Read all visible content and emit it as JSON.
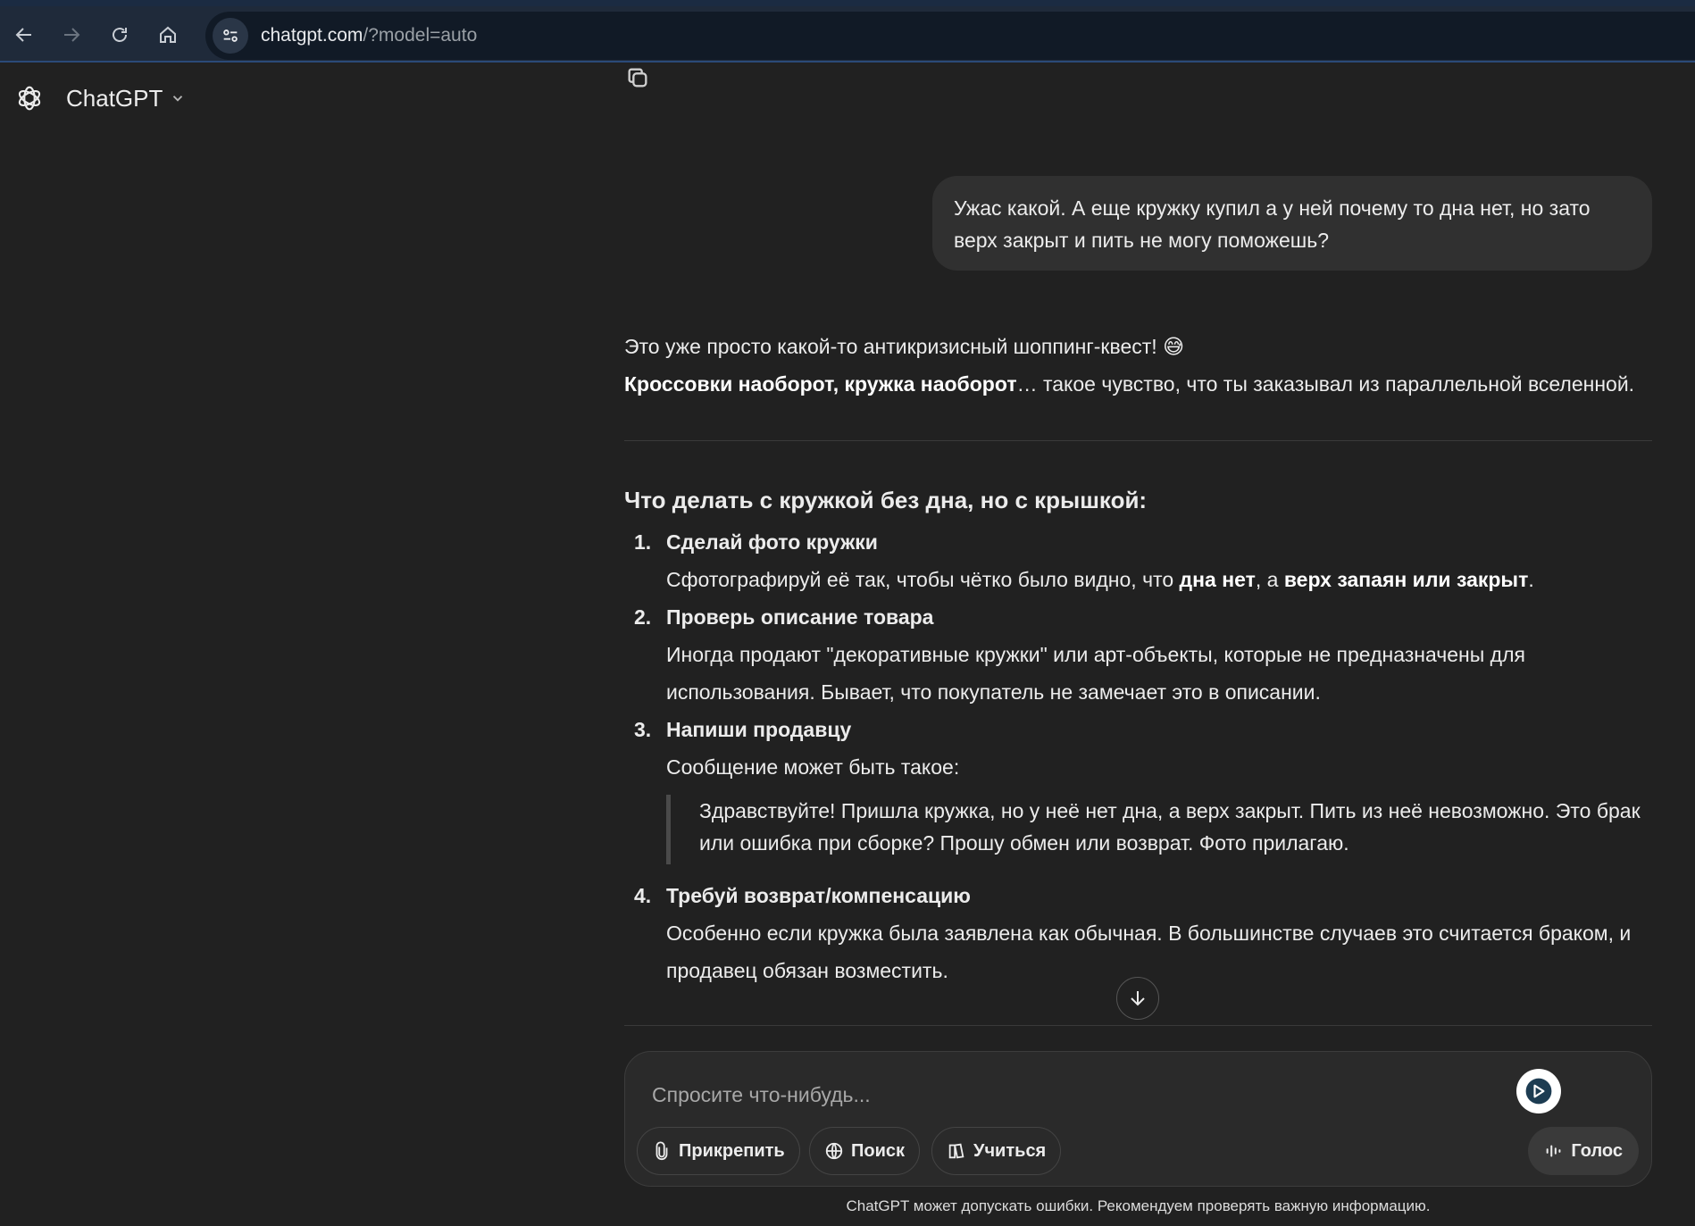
{
  "browser": {
    "url_host": "chatgpt.com",
    "url_path": "/?model=auto"
  },
  "app": {
    "title": "ChatGPT"
  },
  "conversation": {
    "user_message": "Ужас какой. А еще кружку купил а у ней почему то дна нет, но зато верх закрыт и пить не могу поможешь?",
    "assistant": {
      "line1": "Это уже просто какой-то антикризисный шоппинг-квест! 😅",
      "line2_bold": "Кроссовки наоборот, кружка наоборот",
      "line2_rest": "… такое чувство, что ты заказывал из параллельной вселенной.",
      "heading": "Что делать с кружкой без дна, но с крышкой:",
      "items": [
        {
          "num": "1.",
          "title": "Сделай фото кружки",
          "text_a": "Сфотографируй её так, чтобы чётко было видно, что ",
          "bold_a": "дна нет",
          "text_b": ", а ",
          "bold_b": "верх запаян или закрыт",
          "text_c": "."
        },
        {
          "num": "2.",
          "title": "Проверь описание товара",
          "text": "Иногда продают \"декоративные кружки\" или арт-объекты, которые не предназначены для использования. Бывает, что покупатель не замечает это в описании."
        },
        {
          "num": "3.",
          "title": "Напиши продавцу",
          "text": "Сообщение может быть такое:",
          "quote": "Здравствуйте! Пришла кружка, но у неё нет дна, а верх закрыт. Пить из неё невозможно. Это брак или ошибка при сборке? Прошу обмен или возврат. Фото прилагаю."
        },
        {
          "num": "4.",
          "title": "Требуй возврат/компенсацию",
          "text": "Особенно если кружка была заявлена как обычная. В большинстве случаев это считается браком, и продавец обязан возместить."
        }
      ]
    }
  },
  "composer": {
    "placeholder": "Спросите что-нибудь...",
    "attach_label": "Прикрепить",
    "search_label": "Поиск",
    "study_label": "Учиться",
    "voice_label": "Голос"
  },
  "footer": {
    "disclaimer": "ChatGPT может допускать ошибки. Рекомендуем проверять важную информацию."
  },
  "colors": {
    "background": "#212121",
    "bubble": "#303030",
    "browser_bar": "#1f2a3a"
  }
}
